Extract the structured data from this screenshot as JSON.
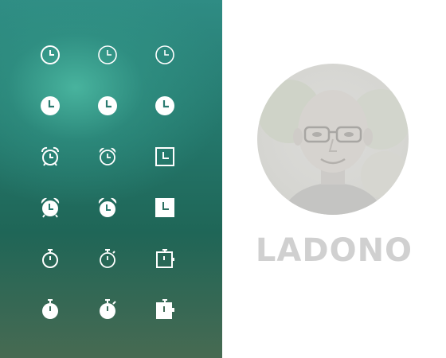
{
  "icons": [
    {
      "name": "clock-outline-icon"
    },
    {
      "name": "clock-thin-outline-icon"
    },
    {
      "name": "clock-thin-outline-icon"
    },
    {
      "name": "clock-solid-icon"
    },
    {
      "name": "clock-solid-icon"
    },
    {
      "name": "clock-solid-icon"
    },
    {
      "name": "alarm-clock-outline-icon"
    },
    {
      "name": "alarm-clock-outline-icon"
    },
    {
      "name": "square-clock-outline-icon"
    },
    {
      "name": "alarm-clock-solid-icon"
    },
    {
      "name": "alarm-clock-solid-icon"
    },
    {
      "name": "square-clock-solid-icon"
    },
    {
      "name": "stopwatch-outline-icon"
    },
    {
      "name": "stopwatch-outline-icon"
    },
    {
      "name": "square-timer-outline-icon"
    },
    {
      "name": "stopwatch-solid-icon"
    },
    {
      "name": "stopwatch-solid-icon"
    },
    {
      "name": "square-timer-solid-icon"
    }
  ],
  "brand": {
    "logo_text": "LADONO"
  },
  "colors": {
    "panel_accent": "#2f8c84",
    "logo": "#d0d0d0"
  }
}
